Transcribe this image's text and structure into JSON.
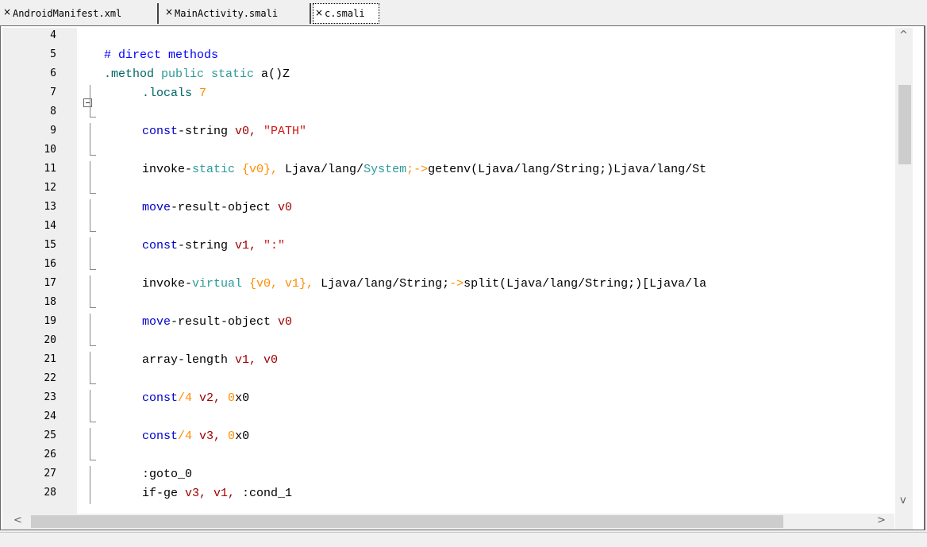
{
  "tabs": [
    {
      "label": "AndroidManifest.xml",
      "active": false
    },
    {
      "label": "MainActivity.smali",
      "active": false
    },
    {
      "label": "c.smali",
      "active": true
    }
  ],
  "close_glyph": "×",
  "editor": {
    "lines": [
      {
        "n": "4"
      },
      {
        "n": "5",
        "tokens": [
          {
            "t": "# direct methods",
            "c": "comment"
          }
        ]
      },
      {
        "n": "6",
        "tokens": [
          {
            "t": ".method",
            "c": "dir"
          },
          {
            "t": " public static ",
            "c": "kw"
          },
          {
            "t": "a()Z",
            "c": "plain"
          }
        ],
        "left": true
      },
      {
        "n": "7",
        "tokens": [
          {
            "t": ".locals",
            "c": "dir"
          },
          {
            "t": " 7",
            "c": "num"
          }
        ]
      },
      {
        "n": "8"
      },
      {
        "n": "9",
        "tokens": [
          {
            "t": "const",
            "c": "op"
          },
          {
            "t": "-string ",
            "c": "plain"
          },
          {
            "t": "v0, ",
            "c": "reg"
          },
          {
            "t": "\"PATH\"",
            "c": "str"
          }
        ]
      },
      {
        "n": "10"
      },
      {
        "n": "11",
        "tokens": [
          {
            "t": "invoke-",
            "c": "plain"
          },
          {
            "t": "static",
            "c": "kw"
          },
          {
            "t": " {v0}, ",
            "c": "num"
          },
          {
            "t": "Ljava/lang/",
            "c": "plain"
          },
          {
            "t": "System",
            "c": "kw"
          },
          {
            "t": ";->",
            "c": "num"
          },
          {
            "t": "getenv(Ljava/lang/String;)Ljava/lang/St",
            "c": "plain"
          }
        ]
      },
      {
        "n": "12"
      },
      {
        "n": "13",
        "tokens": [
          {
            "t": "move",
            "c": "op"
          },
          {
            "t": "-result-object ",
            "c": "plain"
          },
          {
            "t": "v0",
            "c": "reg"
          }
        ]
      },
      {
        "n": "14"
      },
      {
        "n": "15",
        "tokens": [
          {
            "t": "const",
            "c": "op"
          },
          {
            "t": "-string ",
            "c": "plain"
          },
          {
            "t": "v1, ",
            "c": "reg"
          },
          {
            "t": "\":\"",
            "c": "str"
          }
        ]
      },
      {
        "n": "16"
      },
      {
        "n": "17",
        "tokens": [
          {
            "t": "invoke-",
            "c": "plain"
          },
          {
            "t": "virtual",
            "c": "kw"
          },
          {
            "t": " {v0, v1}, ",
            "c": "num"
          },
          {
            "t": "Ljava/lang/String;",
            "c": "plain"
          },
          {
            "t": "->",
            "c": "num"
          },
          {
            "t": "split(Ljava/lang/String;)[Ljava/la",
            "c": "plain"
          }
        ]
      },
      {
        "n": "18"
      },
      {
        "n": "19",
        "tokens": [
          {
            "t": "move",
            "c": "op"
          },
          {
            "t": "-result-object ",
            "c": "plain"
          },
          {
            "t": "v0",
            "c": "reg"
          }
        ]
      },
      {
        "n": "20"
      },
      {
        "n": "21",
        "tokens": [
          {
            "t": "array-length ",
            "c": "plain"
          },
          {
            "t": "v1, v0",
            "c": "reg"
          }
        ]
      },
      {
        "n": "22"
      },
      {
        "n": "23",
        "tokens": [
          {
            "t": "const",
            "c": "op"
          },
          {
            "t": "/4 ",
            "c": "num"
          },
          {
            "t": "v2, ",
            "c": "reg"
          },
          {
            "t": "0",
            "c": "num"
          },
          {
            "t": "x0",
            "c": "plain"
          }
        ]
      },
      {
        "n": "24"
      },
      {
        "n": "25",
        "tokens": [
          {
            "t": "const",
            "c": "op"
          },
          {
            "t": "/4 ",
            "c": "num"
          },
          {
            "t": "v3, ",
            "c": "reg"
          },
          {
            "t": "0",
            "c": "num"
          },
          {
            "t": "x0",
            "c": "plain"
          }
        ]
      },
      {
        "n": "26"
      },
      {
        "n": "27",
        "tokens": [
          {
            "t": ":goto_0",
            "c": "plain"
          }
        ]
      },
      {
        "n": "28",
        "tokens": [
          {
            "t": "if-ge ",
            "c": "plain"
          },
          {
            "t": "v3, v1, ",
            "c": "reg"
          },
          {
            "t": ":cond_1",
            "c": "plain"
          }
        ]
      }
    ]
  },
  "scroll": {
    "up": "^",
    "down": "v",
    "left": "<",
    "right": ">"
  },
  "colors": {
    "comment": "#0000ff",
    "directive": "#006464",
    "keyword": "#2b9999",
    "number": "#ff8c00",
    "string": "#d01818",
    "register": "#a00000"
  }
}
